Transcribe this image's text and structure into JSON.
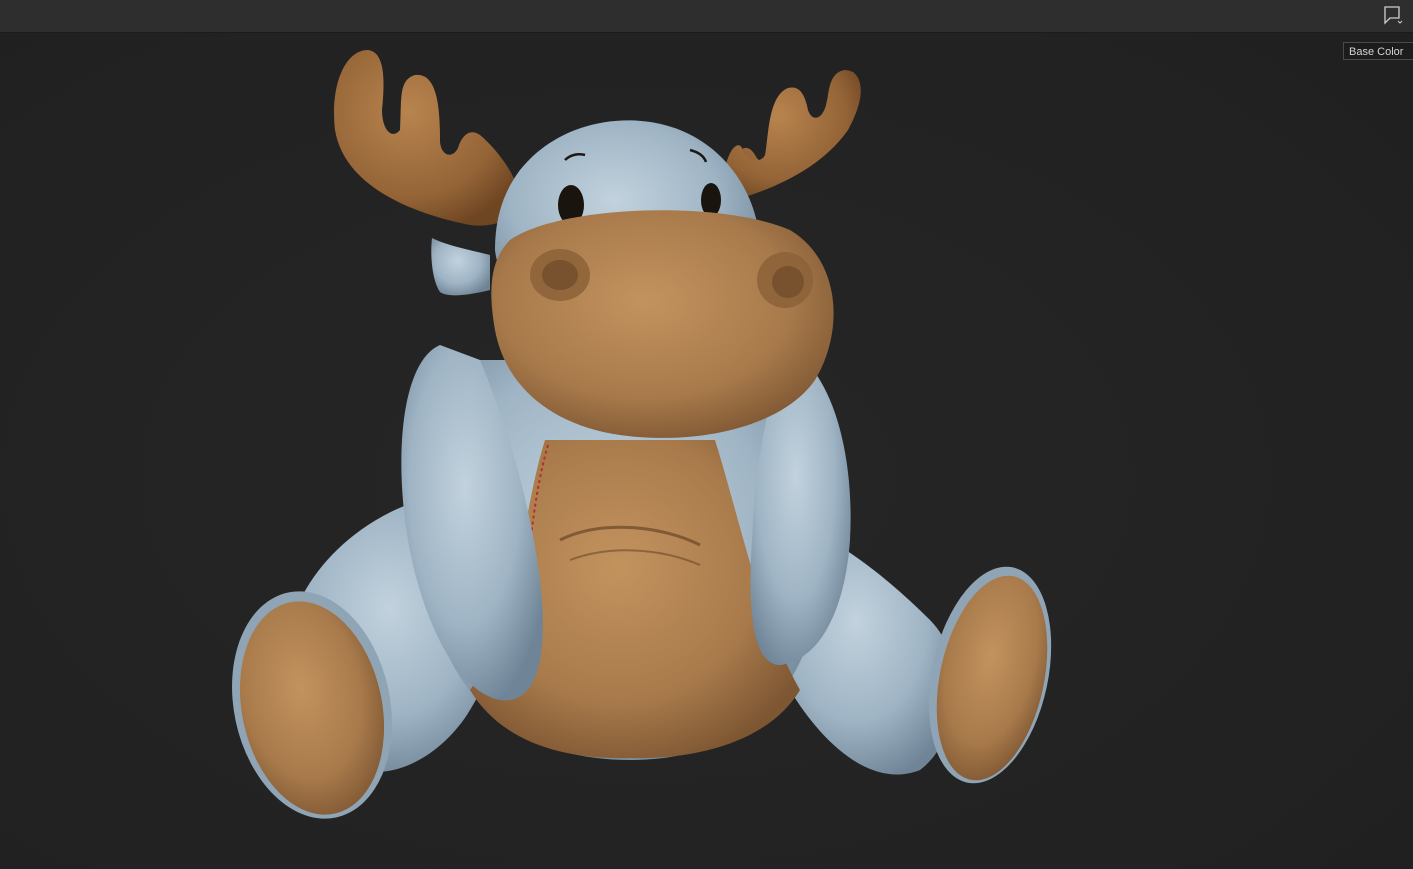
{
  "toolbar": {
    "display_menu_icon": "viewport-display-icon"
  },
  "viewport": {
    "channel_selector": {
      "selected": "Base Color"
    },
    "model": {
      "subject": "plush-moose",
      "colors": {
        "fabric_blue": "#9fb3c3",
        "suede_tan": "#a97c4e",
        "antler_brown": "#9a6a3c",
        "stitch_red": "#b4302a",
        "background": "#242424"
      }
    }
  }
}
